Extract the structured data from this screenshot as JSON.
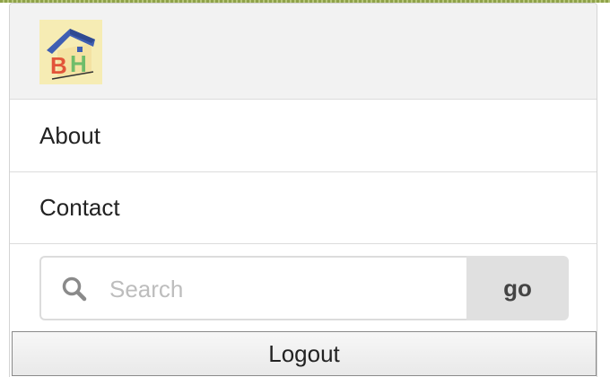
{
  "logo": {
    "letters": "BH",
    "icon": "house-logo-icon",
    "colors": {
      "background": "#f6ecb4",
      "roof": "#3f5fb3",
      "letter_b": "#e2553a",
      "letter_h": "#6fbd6a"
    }
  },
  "menu": {
    "items": [
      {
        "label": "About"
      },
      {
        "label": "Contact"
      }
    ]
  },
  "search": {
    "icon": "search-icon",
    "placeholder": "Search",
    "value": "",
    "button_label": "go"
  },
  "logout": {
    "label": "Logout"
  }
}
